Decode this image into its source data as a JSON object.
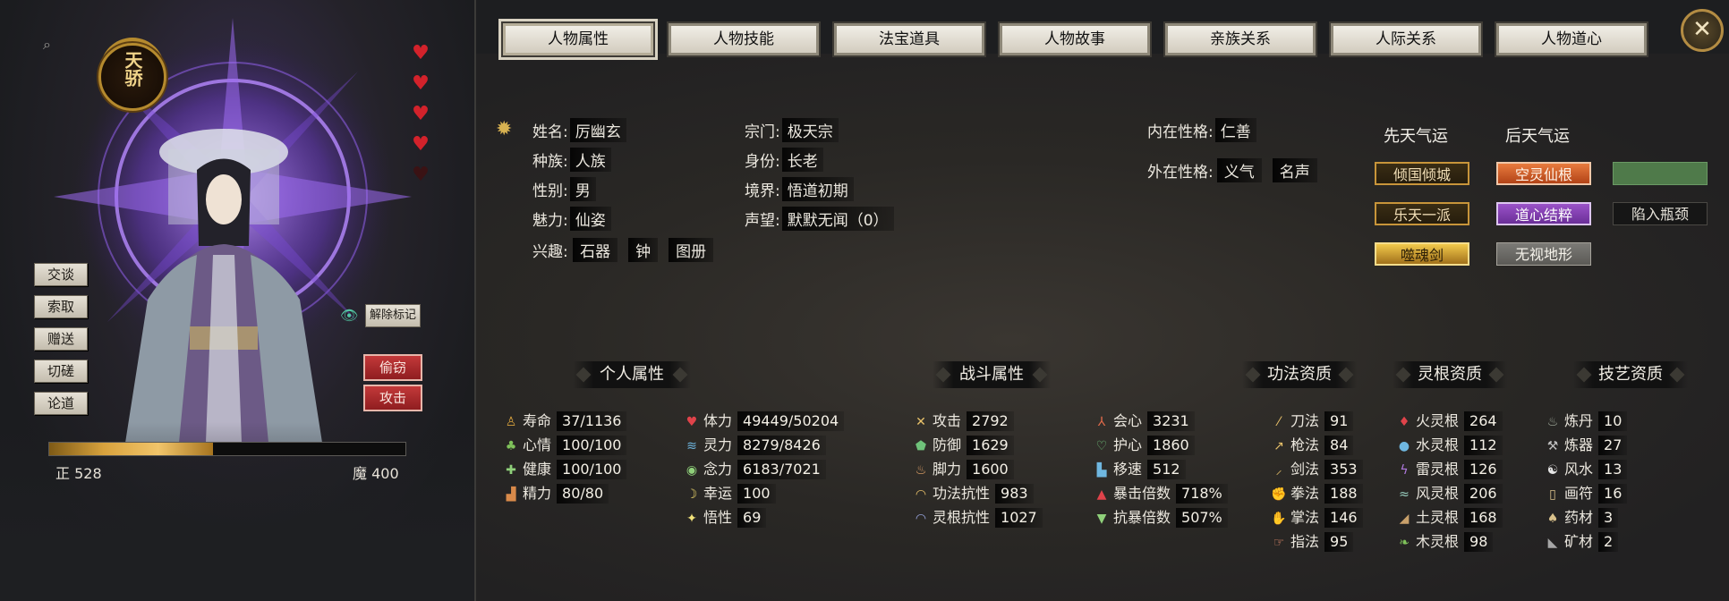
{
  "portrait": {
    "seal_text": "天骄",
    "actions": [
      "交谈",
      "索取",
      "赠送",
      "切磋",
      "论道"
    ],
    "unmark_label": "解除标记",
    "red_actions": [
      "偷窃",
      "攻击"
    ],
    "hearts_full": 4,
    "hearts_total": 5,
    "alignment": {
      "left_label": "正 528",
      "right_label": "魔 400",
      "fill_fraction": 0.46
    }
  },
  "tabs": [
    "人物属性",
    "人物技能",
    "法宝道具",
    "人物故事",
    "亲族关系",
    "人际关系",
    "人物道心"
  ],
  "active_tab": 0,
  "info": {
    "name_k": "姓名:",
    "name_v": "厉幽玄",
    "race_k": "种族:",
    "race_v": "人族",
    "gender_k": "性别:",
    "gender_v": "男",
    "charm_k": "魅力:",
    "charm_v": "仙姿",
    "hobby_k": "兴趣:",
    "hobbies": [
      "石器",
      "钟",
      "图册"
    ],
    "sect_k": "宗门:",
    "sect_v": "极天宗",
    "identity_k": "身份:",
    "identity_v": "长老",
    "realm_k": "境界:",
    "realm_v": "悟道初期",
    "fame_k": "声望:",
    "fame_v": "默默无闻（0）",
    "inner_k": "内在性格:",
    "inner_v": "仁善",
    "outer_k": "外在性格:",
    "outer_v": [
      "义气",
      "名声"
    ]
  },
  "fortune": {
    "innate_title": "先天气运",
    "acquired_title": "后天气运",
    "innate": [
      "倾国倾城",
      "乐天一派",
      "噬魂剑"
    ],
    "acquired": [
      "空灵仙根",
      "道心结粹",
      "无视地形"
    ],
    "extra": [
      "",
      "陷入瓶颈"
    ]
  },
  "sections": [
    "个人属性",
    "战斗属性",
    "功法资质",
    "灵根资质",
    "技艺资质"
  ],
  "personal": [
    {
      "k": "寿命",
      "v": "37/1136",
      "icon": "person-icon",
      "c": "#d8a23d",
      "g": "♙"
    },
    {
      "k": "心情",
      "v": "100/100",
      "icon": "sprout-icon",
      "c": "#7fc25a",
      "g": "♣"
    },
    {
      "k": "健康",
      "v": "100/100",
      "icon": "plus-icon",
      "c": "#8fd07a",
      "g": "✚"
    },
    {
      "k": "精力",
      "v": "80/80",
      "icon": "boot-icon",
      "c": "#d98a4a",
      "g": "▟"
    }
  ],
  "personal2": [
    {
      "k": "体力",
      "v": "49449/50204",
      "icon": "heart-icon",
      "c": "#e0434a",
      "g": "♥"
    },
    {
      "k": "灵力",
      "v": "8279/8426",
      "icon": "wave-icon",
      "c": "#6fb7e0",
      "g": "≋"
    },
    {
      "k": "念力",
      "v": "6183/7021",
      "icon": "eye-icon",
      "c": "#8fd07a",
      "g": "◉"
    },
    {
      "k": "幸运",
      "v": "100",
      "icon": "moon-icon",
      "c": "#e8d36a",
      "g": "☽"
    },
    {
      "k": "悟性",
      "v": "69",
      "icon": "sparkle-icon",
      "c": "#f2e27a",
      "g": "✦"
    }
  ],
  "combat": [
    {
      "k": "攻击",
      "v": "2792",
      "icon": "swords-icon",
      "c": "#e8c16a",
      "g": "✕"
    },
    {
      "k": "防御",
      "v": "1629",
      "icon": "shield-icon",
      "c": "#6fc27a",
      "g": "⬟"
    },
    {
      "k": "脚力",
      "v": "1600",
      "icon": "foot-icon",
      "c": "#e8a66a",
      "g": "♨"
    },
    {
      "k": "功法抗性",
      "v": "983",
      "icon": "arc-icon",
      "c": "#e8c16a",
      "g": "◠"
    },
    {
      "k": "灵根抗性",
      "v": "1027",
      "icon": "arc-icon",
      "c": "#9aa6e0",
      "g": "◠"
    }
  ],
  "combat2": [
    {
      "k": "会心",
      "v": "3231",
      "icon": "tri-icon",
      "c": "#e06a4a",
      "g": "⅄"
    },
    {
      "k": "护心",
      "v": "1860",
      "icon": "heart-shield-icon",
      "c": "#6fc27a",
      "g": "♡"
    },
    {
      "k": "移速",
      "v": "512",
      "icon": "boot-speed-icon",
      "c": "#6fb7e0",
      "g": "▙"
    },
    {
      "k": "暴击倍数",
      "v": "718%",
      "icon": "crit-icon",
      "c": "#e0434a",
      "g": "▲"
    },
    {
      "k": "抗暴倍数",
      "v": "507%",
      "icon": "anticrit-icon",
      "c": "#8fd07a",
      "g": "▼"
    }
  ],
  "skills": [
    {
      "k": "刀法",
      "v": "91",
      "icon": "blade-icon",
      "c": "#e8c16a",
      "g": "⁄"
    },
    {
      "k": "枪法",
      "v": "84",
      "icon": "spear-icon",
      "c": "#e8c16a",
      "g": "↗"
    },
    {
      "k": "剑法",
      "v": "353",
      "icon": "sword-icon",
      "c": "#e8c16a",
      "g": "⸝"
    },
    {
      "k": "拳法",
      "v": "188",
      "icon": "fist-icon",
      "c": "#e08a6a",
      "g": "✊"
    },
    {
      "k": "掌法",
      "v": "146",
      "icon": "palm-icon",
      "c": "#e08a6a",
      "g": "✋"
    },
    {
      "k": "指法",
      "v": "95",
      "icon": "finger-icon",
      "c": "#e08a6a",
      "g": "☞"
    }
  ],
  "roots": [
    {
      "k": "火灵根",
      "v": "264",
      "icon": "fire-icon",
      "c": "#e0434a",
      "g": "♦"
    },
    {
      "k": "水灵根",
      "v": "112",
      "icon": "water-icon",
      "c": "#6fb7e0",
      "g": "●"
    },
    {
      "k": "雷灵根",
      "v": "126",
      "icon": "thunder-icon",
      "c": "#b07ae0",
      "g": "ϟ"
    },
    {
      "k": "风灵根",
      "v": "206",
      "icon": "wind-icon",
      "c": "#9ad0c0",
      "g": "≈"
    },
    {
      "k": "土灵根",
      "v": "168",
      "icon": "earth-icon",
      "c": "#c8a06a",
      "g": "◢"
    },
    {
      "k": "木灵根",
      "v": "98",
      "icon": "leaf-icon",
      "c": "#7fc25a",
      "g": "❧"
    }
  ],
  "arts": [
    {
      "k": "炼丹",
      "v": "10",
      "icon": "cauldron-icon",
      "c": "#a6b0a0",
      "g": "♨"
    },
    {
      "k": "炼器",
      "v": "27",
      "icon": "hammer-icon",
      "c": "#c0c0c0",
      "g": "⚒"
    },
    {
      "k": "风水",
      "v": "13",
      "icon": "yinyang-icon",
      "c": "#e6e6e6",
      "g": "☯"
    },
    {
      "k": "画符",
      "v": "16",
      "icon": "talisman-icon",
      "c": "#d8c08a",
      "g": "▯"
    },
    {
      "k": "药材",
      "v": "3",
      "icon": "mushroom-icon",
      "c": "#d8c08a",
      "g": "♠"
    },
    {
      "k": "矿材",
      "v": "2",
      "icon": "ore-icon",
      "c": "#a6a6a6",
      "g": "◣"
    }
  ]
}
